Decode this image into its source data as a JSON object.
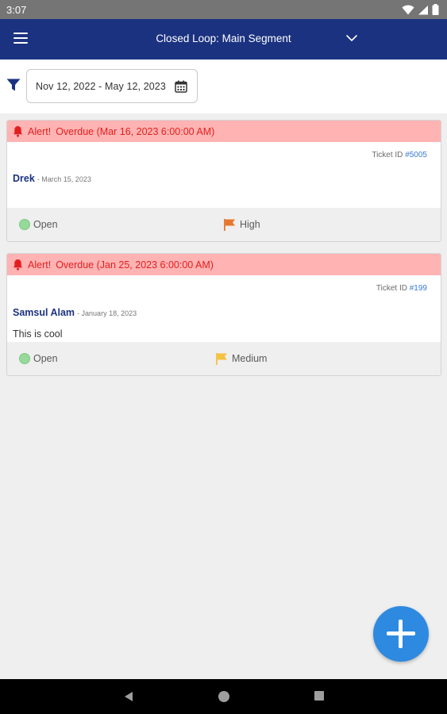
{
  "status_bar": {
    "time": "3:07",
    "icons": [
      "wifi-icon",
      "signal-icon",
      "battery-icon"
    ]
  },
  "app_bar": {
    "title": "Closed Loop: Main Segment",
    "menu_icon": "hamburger-menu-icon",
    "dropdown_icon": "chevron-down-icon"
  },
  "filter": {
    "icon": "filter-icon",
    "date_range": "Nov 12, 2022 - May 12, 2023",
    "calendar_icon": "calendar-icon"
  },
  "tickets": [
    {
      "alert_label": "Alert!",
      "alert_text": "Overdue (Mar 16, 2023 6:00:00 AM)",
      "ticket_id_label": "Ticket ID",
      "ticket_id": "#5005",
      "author": "Drek",
      "date": "- March 15, 2023",
      "description": "",
      "status": "Open",
      "status_color": "#96d99a",
      "priority": "High",
      "priority_color": "#e8762d"
    },
    {
      "alert_label": "Alert!",
      "alert_text": "Overdue (Jan 25, 2023 6:00:00 AM)",
      "ticket_id_label": "Ticket ID",
      "ticket_id": "#199",
      "author": "Samsul Alam",
      "date": "- January 18, 2023",
      "description": "This is cool",
      "status": "Open",
      "status_color": "#96d99a",
      "priority": "Medium",
      "priority_color": "#f5c242"
    }
  ],
  "fab": {
    "icon": "plus-icon"
  },
  "nav": {
    "back_icon": "back-triangle-icon",
    "home_icon": "home-circle-icon",
    "recents_icon": "recents-square-icon"
  },
  "colors": {
    "app_bar": "#1b3280",
    "alert_bg": "#ffb3b3",
    "alert_text": "#e21f1f",
    "fab": "#2e8ae0",
    "link": "#3a7bd5"
  }
}
